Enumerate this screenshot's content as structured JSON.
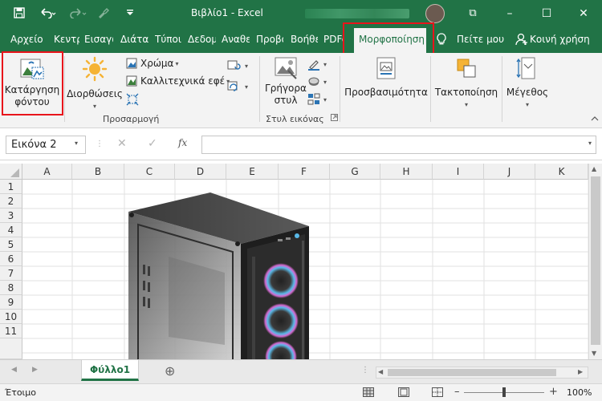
{
  "window": {
    "title": "Βιβλίο1  -  Excel",
    "minimize_glyph": "–",
    "maximize_glyph": "☐",
    "close_glyph": "✕",
    "ribbon_display_glyph": "⧉"
  },
  "tabs": [
    {
      "label": "Αρχείο"
    },
    {
      "label": "Κεντρική"
    },
    {
      "label": "Εισαγωγή"
    },
    {
      "label": "Διάταξη"
    },
    {
      "label": "Τύποι"
    },
    {
      "label": "Δεδομένα"
    },
    {
      "label": "Αναθεώρηση"
    },
    {
      "label": "Προβολή"
    },
    {
      "label": "Βοήθεια"
    },
    {
      "label": "PDFelement"
    },
    {
      "label": "Μορφοποίηση"
    },
    {
      "label": "Πείτε μου"
    },
    {
      "label": "Κοινή χρήση"
    }
  ],
  "ribbon": {
    "remove_bg_line1": "Κατάργηση",
    "remove_bg_line2": "φόντου",
    "corrections": "Διορθώσεις",
    "color": "Χρώμα",
    "artistic": "Καλλιτεχνικά εφέ",
    "adjust_group": "Προσαρμογή",
    "quick_styles_line1": "Γρήγορα",
    "quick_styles_line2": "στυλ",
    "styles_group": "Στυλ εικόνας",
    "accessibility": "Προσβασιμότητα",
    "arrange": "Τακτοποίηση",
    "size": "Μέγεθος"
  },
  "formula": {
    "name_box": "Εικόνα 2",
    "cancel_glyph": "✕",
    "enter_glyph": "✓",
    "fx": "fx"
  },
  "columns": [
    "A",
    "B",
    "C",
    "D",
    "E",
    "F",
    "G",
    "H",
    "I",
    "J",
    "K"
  ],
  "rows": [
    "1",
    "2",
    "3",
    "4",
    "5",
    "6",
    "7",
    "8",
    "9",
    "10",
    "11"
  ],
  "sheet": {
    "name": "Φύλλο1",
    "add_glyph": "⊕"
  },
  "status": {
    "ready": "Έτοιμο",
    "zoom": "100%",
    "minus": "–",
    "plus": "+"
  },
  "colors": {
    "brand": "#217346",
    "highlight": "#e8141b"
  }
}
